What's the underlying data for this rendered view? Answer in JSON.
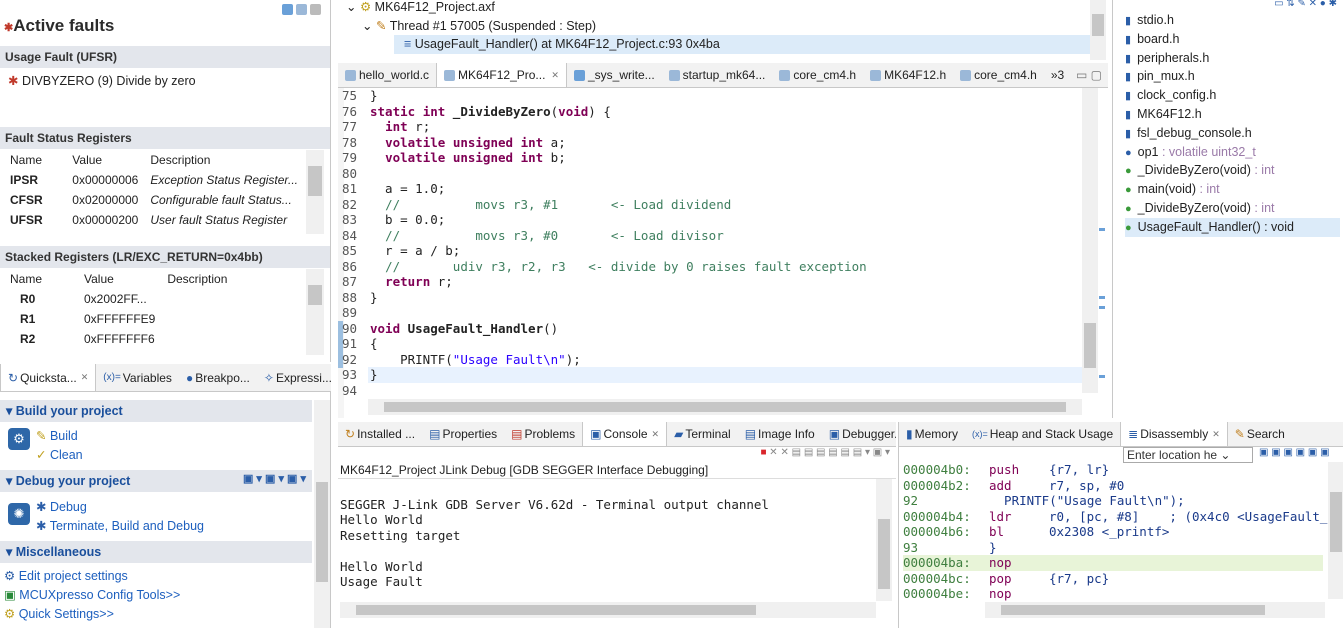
{
  "debug_tree": {
    "items": [
      {
        "label": "MK64F12_Project.axf"
      },
      {
        "label": "Thread #1 57005 (Suspended : Step)"
      },
      {
        "label": "UsageFault_Handler() at MK64F12_Project.c:93 0x4ba"
      }
    ]
  },
  "fault_panel": {
    "title": "Active faults",
    "usage_fault_header": "Usage Fault (UFSR)",
    "usage_fault_item": "DIVBYZERO (9) Divide by zero",
    "fsr_header": "Fault Status Registers",
    "columns": [
      "Name",
      "Value",
      "Description"
    ],
    "fsr_rows": [
      {
        "name": "IPSR",
        "value": "0x00000006",
        "desc": "Exception Status Register..."
      },
      {
        "name": "CFSR",
        "value": "0x02000000",
        "desc": "Configurable fault Status..."
      },
      {
        "name": "UFSR",
        "value": "0x00000200",
        "desc": "User fault Status Register"
      }
    ],
    "stacked_header": "Stacked Registers (LR/EXC_RETURN=0x4bb)",
    "stacked_rows": [
      {
        "name": "R0",
        "value": "0x2002FF..."
      },
      {
        "name": "R1",
        "value": "0xFFFFFFE9"
      },
      {
        "name": "R2",
        "value": "0xFFFFFFF6"
      }
    ]
  },
  "editor": {
    "tabs": [
      "hello_world.c",
      "MK64F12_Pro...",
      "_sys_write...",
      "startup_mk64...",
      "core_cm4.h",
      "MK64F12.h",
      "core_cm4.h"
    ],
    "overflow_count": "»3",
    "code": [
      {
        "n": "75",
        "t": "}"
      },
      {
        "n": "76",
        "t": "static int _DivideByZero(void) {"
      },
      {
        "n": "77",
        "t": "  int r;"
      },
      {
        "n": "78",
        "t": "  volatile unsigned int a;"
      },
      {
        "n": "79",
        "t": "  volatile unsigned int b;"
      },
      {
        "n": "80",
        "t": ""
      },
      {
        "n": "81",
        "t": "  a = 1.0;"
      },
      {
        "n": "82",
        "t": "  //          movs r3, #1       <- Load dividend"
      },
      {
        "n": "83",
        "t": "  b = 0.0;"
      },
      {
        "n": "84",
        "t": "  //          movs r3, #0       <- Load divisor"
      },
      {
        "n": "85",
        "t": "  r = a / b;"
      },
      {
        "n": "86",
        "t": "  //       udiv r3, r2, r3   <- divide by 0 raises fault exception"
      },
      {
        "n": "87",
        "t": "  return r;"
      },
      {
        "n": "88",
        "t": "}"
      },
      {
        "n": "89",
        "t": ""
      },
      {
        "n": "90",
        "t": "void UsageFault_Handler()"
      },
      {
        "n": "91",
        "t": "{"
      },
      {
        "n": "92",
        "t": "    PRINTF(\"Usage Fault\\n\");"
      },
      {
        "n": "93",
        "t": "}"
      },
      {
        "n": "94",
        "t": ""
      }
    ]
  },
  "outline": {
    "items": [
      {
        "label": "stdio.h",
        "suffix": "",
        "color": "#2b5ea8"
      },
      {
        "label": "board.h",
        "suffix": "",
        "color": "#2b5ea8"
      },
      {
        "label": "peripherals.h",
        "suffix": "",
        "color": "#2b5ea8"
      },
      {
        "label": "pin_mux.h",
        "suffix": "",
        "color": "#2b5ea8"
      },
      {
        "label": "clock_config.h",
        "suffix": "",
        "color": "#2b5ea8"
      },
      {
        "label": "MK64F12.h",
        "suffix": "",
        "color": "#2b5ea8"
      },
      {
        "label": "fsl_debug_console.h",
        "suffix": "",
        "color": "#2b5ea8"
      },
      {
        "label": "op1",
        "suffix": " : volatile uint32_t",
        "color": "#2b5ea8"
      },
      {
        "label": "_DivideByZero(void)",
        "suffix": " : int",
        "color": "#3a9a3a"
      },
      {
        "label": "main(void)",
        "suffix": " : int",
        "color": "#3a9a3a"
      },
      {
        "label": "_DivideByZero(void)",
        "suffix": " : int",
        "color": "#3a9a3a"
      },
      {
        "label": "UsageFault_Handler() : void",
        "suffix": "",
        "color": "#3a9a3a"
      }
    ]
  },
  "quickstart": {
    "tabs": [
      "Quicksta...",
      "Variables",
      "Breakpo...",
      "Expressi..."
    ],
    "build_header": "Build your project",
    "build_links": [
      "Build",
      "Clean"
    ],
    "debug_header": "Debug your project",
    "debug_links": [
      "Debug",
      "Terminate, Build and Debug"
    ],
    "misc_header": "Miscellaneous",
    "misc_links": [
      "Edit project settings",
      "MCUXpresso Config Tools>>",
      "Quick Settings>>"
    ]
  },
  "console": {
    "tabs": [
      "Installed ...",
      "Properties",
      "Problems",
      "Console",
      "Terminal",
      "Image Info",
      "Debugger..."
    ],
    "session": "MK64F12_Project JLink Debug [GDB SEGGER Interface Debugging]",
    "lines": [
      "",
      "SEGGER J-Link GDB Server V6.62d - Terminal output channel",
      "Hello World",
      "Resetting target",
      "",
      "Hello World",
      "Usage Fault"
    ]
  },
  "disassembly": {
    "tabs": [
      "Memory",
      "Heap and Stack Usage",
      "Disassembly",
      "Search"
    ],
    "location_placeholder": "Enter location he",
    "lines": [
      {
        "addr": "000004b0:",
        "op": "push",
        "args": "{r7, lr}",
        "hl": false
      },
      {
        "addr": "000004b2:",
        "op": "add",
        "args": "r7, sp, #0",
        "hl": false
      },
      {
        "addr": "92",
        "op": "",
        "args": "  PRINTF(\"Usage Fault\\n\");",
        "hl": false
      },
      {
        "addr": "000004b4:",
        "op": "ldr",
        "args": "r0, [pc, #8]    ; (0x4c0 <UsageFault_",
        "hl": false
      },
      {
        "addr": "000004b6:",
        "op": "bl",
        "args": "0x2308 <_printf>",
        "hl": false
      },
      {
        "addr": "93",
        "op": "",
        "args": "}",
        "hl": false
      },
      {
        "addr": "000004ba:",
        "op": "nop",
        "args": "",
        "hl": true
      },
      {
        "addr": "000004bc:",
        "op": "pop",
        "args": "{r7, pc}",
        "hl": false
      },
      {
        "addr": "000004be:",
        "op": "nop",
        "args": "",
        "hl": false
      }
    ]
  }
}
